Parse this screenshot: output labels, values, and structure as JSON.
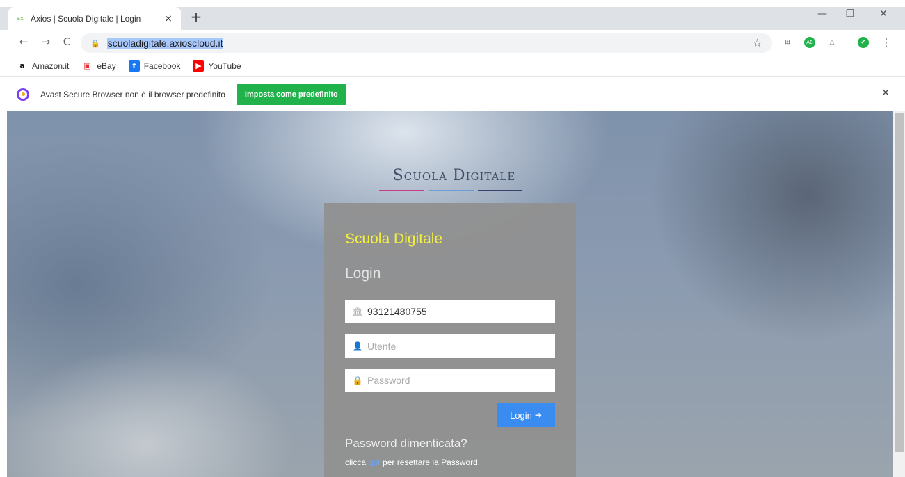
{
  "tab": {
    "favicon": "axios-favicon",
    "title": "Axios | Scuola Digitale | Login",
    "close": "×",
    "new": "+"
  },
  "window": {
    "minimize": "—",
    "restore": "❐",
    "close": "✕"
  },
  "toolbar": {
    "back": "←",
    "forward": "→",
    "reload": "C",
    "url": "scuoladigitale.axioscloud.it",
    "lock": "🔒",
    "star": "☆"
  },
  "extensions": [
    {
      "name": "grid-icon",
      "glyph": "⊞",
      "color": "#555555"
    },
    {
      "name": "adblock-icon",
      "glyph": "AB",
      "color": "#21b24b"
    },
    {
      "name": "avast-passwords-icon",
      "glyph": "△",
      "color": "#888888"
    },
    {
      "name": "avast-online-security-icon",
      "glyph": "✔",
      "color": "#21b24b"
    },
    {
      "name": "menu-icon",
      "glyph": "⋮",
      "color": "#555555"
    }
  ],
  "bookmarks": [
    {
      "label": "Amazon.it",
      "icon": "a",
      "icon_name": "amazon-icon",
      "bg": "#ffffff",
      "fg": "#111111"
    },
    {
      "label": "eBay",
      "icon": "▣",
      "icon_name": "ebay-bag-icon",
      "bg": "#ffffff",
      "fg": "#e53238"
    },
    {
      "label": "Facebook",
      "icon": "f",
      "icon_name": "facebook-icon",
      "bg": "#1877f2",
      "fg": "#ffffff"
    },
    {
      "label": "YouTube",
      "icon": "▶",
      "icon_name": "youtube-icon",
      "bg": "#ff0000",
      "fg": "#ffffff"
    }
  ],
  "infobar": {
    "message": "Avast Secure Browser non è il browser predefinito",
    "button": "Imposta come predefinito",
    "close": "✕"
  },
  "page": {
    "brand": "Scuola Digitale",
    "brand_lines": [
      "#c83d8a",
      "#6a9fd8",
      "#3b3f6b"
    ],
    "title": "Scuola Digitale",
    "subtitle": "Login",
    "school_code": {
      "value": "93121480755",
      "icon": "🏛"
    },
    "user": {
      "placeholder": "Utente",
      "icon": "👤"
    },
    "password": {
      "placeholder": "Password",
      "icon": "🔒"
    },
    "login_button": "Login",
    "login_arrow": "➔",
    "forgot": "Password dimenticata?",
    "reset_prefix": "clicca",
    "reset_link": "qui",
    "reset_suffix": "per resettare la Password."
  },
  "colors": {
    "accent_title": "#f5f03c",
    "login_button": "#3a8cf0",
    "infobar_button": "#21b24b"
  }
}
